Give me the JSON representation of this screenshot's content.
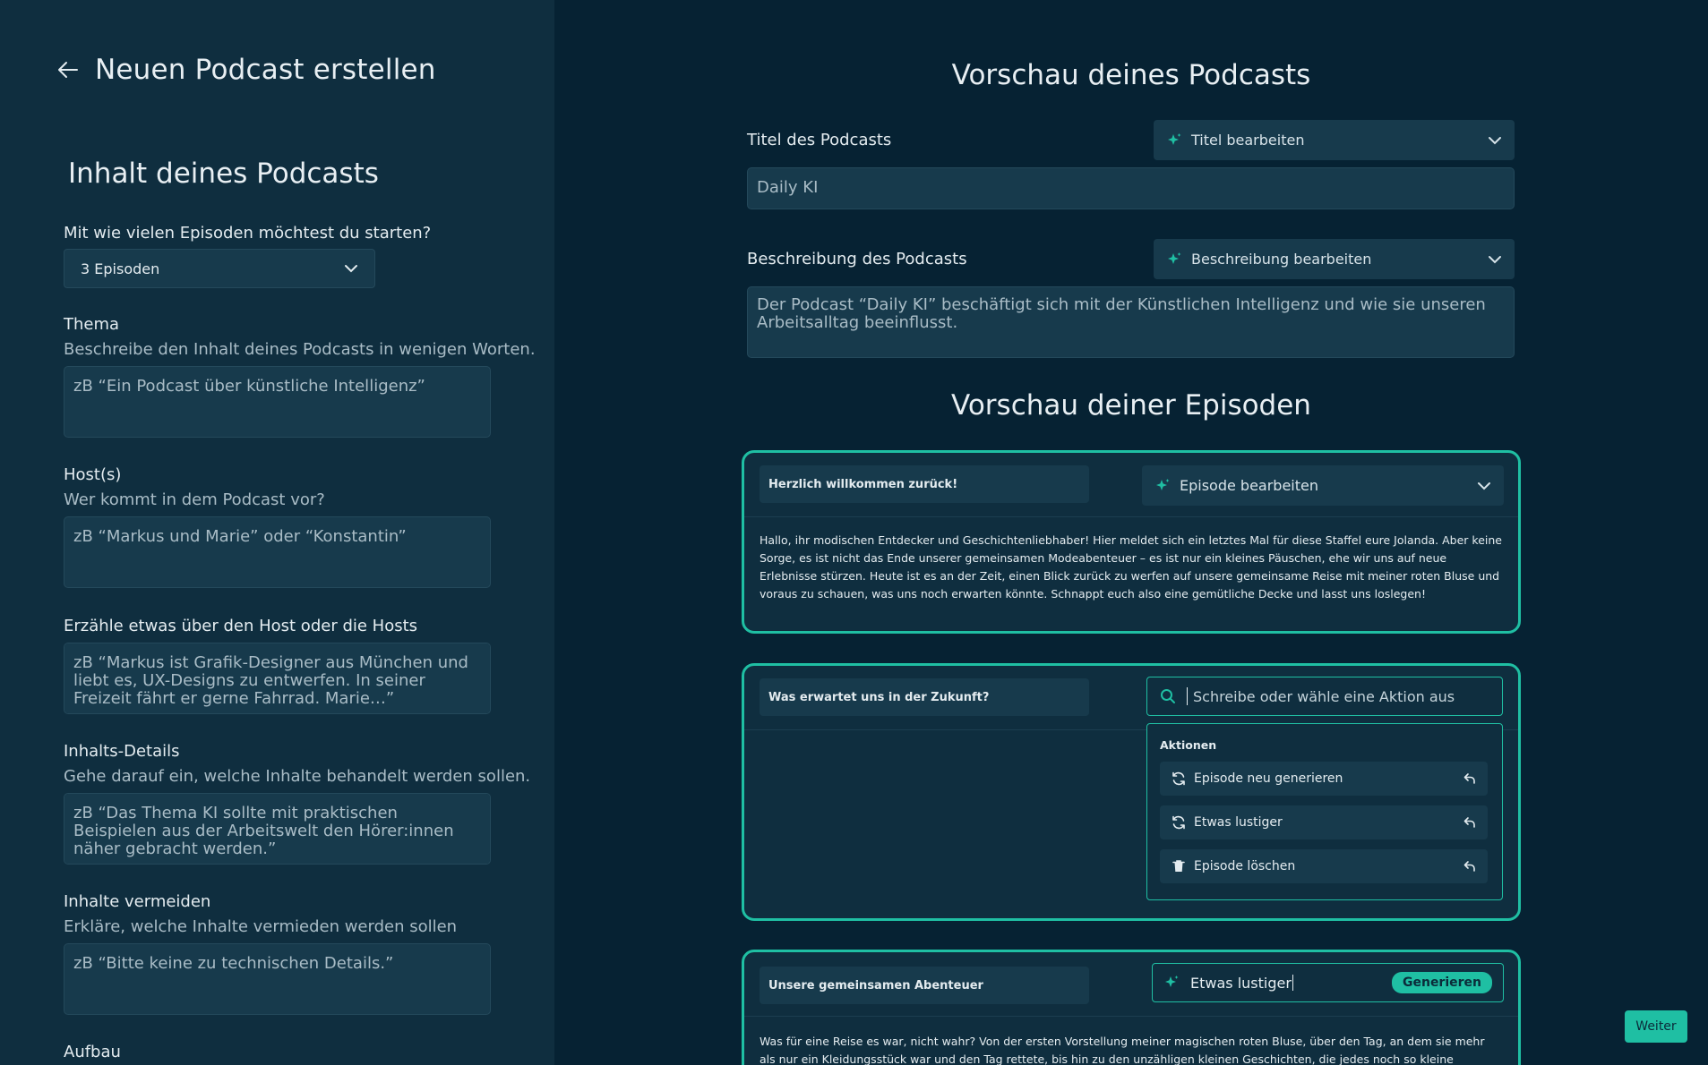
{
  "header": {
    "title": "Neuen Podcast erstellen"
  },
  "form": {
    "section_title": "Inhalt deines Podcasts",
    "episodes": {
      "label": "Mit wie vielen Episoden möchtest du starten?",
      "value": "3 Episoden"
    },
    "thema": {
      "label": "Thema",
      "help": "Beschreibe den Inhalt deines Podcasts in wenigen Worten.",
      "placeholder": "zB “Ein Podcast über künstliche Intelligenz”"
    },
    "hosts": {
      "label": "Host(s)",
      "help": "Wer kommt in dem Podcast vor?",
      "placeholder": "zB “Markus und Marie” oder “Konstantin”"
    },
    "host_info": {
      "label": "Erzähle etwas über den Host oder die Hosts",
      "placeholder": "zB “Markus ist Grafik-Designer aus München und liebt es, UX-Designs zu entwerfen. In seiner Freizeit fährt er gerne Fahrrad. Marie…”"
    },
    "details": {
      "label": "Inhalts-Details",
      "help": "Gehe darauf ein, welche Inhalte behandelt werden sollen.",
      "placeholder": "zB “Das Thema KI sollte mit praktischen Beispielen aus der Arbeitswelt den Hörer:innen näher gebracht werden.”"
    },
    "avoid": {
      "label": "Inhalte vermeiden",
      "help": "Erkläre, welche Inhalte vermieden werden sollen",
      "placeholder": "zB “Bitte keine zu technischen Details.”"
    },
    "aufbau": {
      "label": "Aufbau"
    }
  },
  "preview": {
    "title": "Vorschau deines Podcasts",
    "podcast_title": {
      "label": "Titel des Podcasts",
      "edit": "Titel bearbeiten",
      "value": "Daily KI"
    },
    "podcast_desc": {
      "label": "Beschreibung des Podcasts",
      "edit": "Beschreibung bearbeiten",
      "value": "Der Podcast “Daily KI” beschäftigt sich mit der Künstlichen Intelligenz und wie sie unseren Arbeitsalltag beeinflusst."
    },
    "episodes_title": "Vorschau deiner Episoden",
    "episodes": [
      {
        "title": "Herzlich willkommen zurück!",
        "edit": "Episode bearbeiten",
        "text": "Hallo, ihr modischen Entdecker und Geschichtenliebhaber! Hier meldet sich ein letztes Mal für diese Staffel eure Jolanda. Aber keine Sorge, es ist nicht das Ende unserer gemeinsamen Modeabenteuer – es ist nur ein kleines Päuschen, ehe wir uns auf neue Erlebnisse stürzen. Heute ist es an der Zeit, einen Blick zurück zu werfen auf unsere gemeinsame Reise mit meiner roten Bluse und voraus zu schauen, was uns noch erwarten könnte. Schnappt euch also eine gemütliche Decke und lasst uns loslegen!"
      },
      {
        "title": "Was erwartet uns in der Zukunft?",
        "search_placeholder": "Schreibe oder wähle eine Aktion aus",
        "actions_title": "Aktionen",
        "actions": [
          "Episode neu generieren",
          "Etwas lustiger",
          "Episode löschen"
        ]
      },
      {
        "title": "Unsere gemeinsamen Abenteuer",
        "input_value": "Etwas lustiger",
        "generate_label": "Generieren",
        "text": "Was für eine Reise es war, nicht wahr? Von der ersten Vorstellung meiner magischen roten Bluse, über den Tag, an dem sie mehr als nur ein Kleidungsstück war und den Tag rettete, bis hin zu den unzähligen kleinen Geschichten, die jedes noch so kleine Fädchen dieser Bluse"
      }
    ]
  },
  "footer": {
    "next_label": "Weiter"
  },
  "colors": {
    "accent": "#1fbfa3",
    "panel": "#0f2e3f",
    "background": "#062233",
    "field": "#173a4c"
  }
}
